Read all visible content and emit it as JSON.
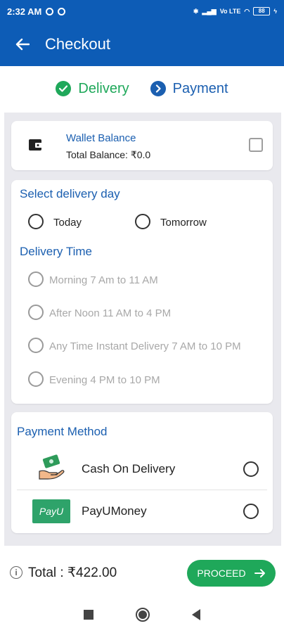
{
  "status_bar": {
    "time": "2:32 AM",
    "battery": "88",
    "network": "Vo LTE"
  },
  "header": {
    "title": "Checkout"
  },
  "steps": {
    "delivery": "Delivery",
    "payment": "Payment"
  },
  "wallet": {
    "title": "Wallet Balance",
    "balance": "Total Balance: ₹0.0",
    "checked": false
  },
  "delivery_day": {
    "title": "Select delivery day",
    "options": [
      "Today",
      "Tomorrow"
    ]
  },
  "delivery_time": {
    "title": "Delivery Time",
    "options": [
      "Morning 7 Am to 11 AM",
      "After Noon 11 AM to 4 PM",
      "Any Time Instant Delivery 7 AM to 10 PM",
      "Evening 4 PM to 10 PM"
    ]
  },
  "payment": {
    "title": "Payment Method",
    "methods": [
      "Cash On Delivery",
      "PayUMoney"
    ],
    "payu_logo": "PayU"
  },
  "footer": {
    "total_label": "Total : ₹422.00",
    "proceed": "PROCEED"
  },
  "colors": {
    "primary": "#0d5cb6",
    "accent_green": "#1fa85a",
    "link_blue": "#1b5fb0"
  },
  "icons": [
    "back-arrow-icon",
    "check-icon",
    "chevron-right-icon",
    "wallet-icon",
    "cash-hand-icon",
    "info-icon",
    "arrow-right-icon"
  ]
}
